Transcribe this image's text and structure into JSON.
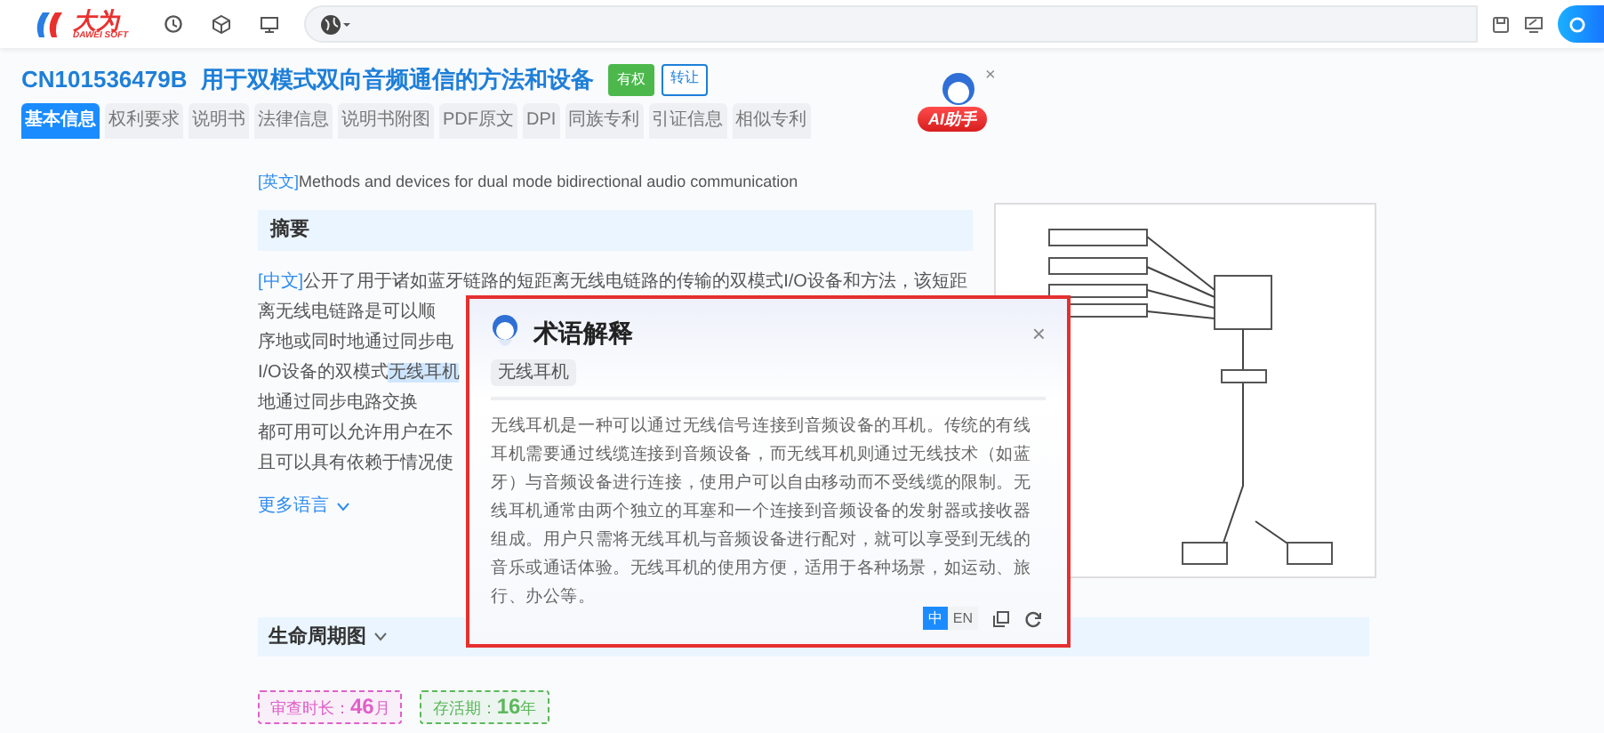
{
  "header": {
    "logo": {
      "name": "大为",
      "subtitle": "DAWEI SOFT"
    }
  },
  "patent": {
    "number": "CN101536479B",
    "title": "用于双模式双向音频通信的方法和设备",
    "tags": [
      {
        "label": "有权",
        "kind": "solid"
      },
      {
        "label": "转让",
        "kind": "outline"
      }
    ]
  },
  "tabs": [
    {
      "label": "基本信息",
      "selected": true
    },
    {
      "label": "权利要求",
      "selected": false
    },
    {
      "label": "说明书",
      "selected": false
    },
    {
      "label": "法律信息",
      "selected": false
    },
    {
      "label": "说明书附图",
      "selected": false
    },
    {
      "label": "PDF原文",
      "selected": false
    },
    {
      "label": "DPI",
      "selected": false
    },
    {
      "label": "同族专利",
      "selected": false
    },
    {
      "label": "引证信息",
      "selected": false
    },
    {
      "label": "相似专利",
      "selected": false
    }
  ],
  "assistant": {
    "label": "AI助手",
    "close": "×"
  },
  "english": {
    "tag": "[英文]",
    "text": "Methods and devices for dual mode bidirectional audio communication"
  },
  "abstract": {
    "heading": "摘要",
    "tag": "[中文]",
    "lines": [
      {
        "segments": [
          {
            "text": "公开了用于诸如蓝牙链路的短距离无线电链路的传输的双模式I/O设备和方法，该短距离无线电链路是可以顺",
            "highlighted": false
          }
        ]
      },
      {
        "segments": [
          {
            "text": "序地或同时地通过同步电",
            "highlighted": false
          }
        ]
      },
      {
        "segments": [
          {
            "text": "I/O设备的双模式",
            "highlighted": false
          },
          {
            "text": "无线耳机",
            "highlighted": true
          }
        ]
      },
      {
        "segments": [
          {
            "text": "地通过同步电路交换",
            "highlighted": false
          }
        ]
      },
      {
        "segments": [
          {
            "text": "都可用可以允许用户在不",
            "highlighted": false
          }
        ]
      },
      {
        "segments": [
          {
            "text": "且可以具有依赖于情况使",
            "highlighted": false
          }
        ]
      }
    ]
  },
  "more_languages": "更多语言",
  "lifecycle": {
    "heading": "生命周期图",
    "metrics": [
      {
        "label": "审查时长：",
        "value": "46",
        "unit": "月",
        "color": "#e060c8"
      },
      {
        "label": "存活期：",
        "value": "16",
        "unit": "年",
        "color": "#5cb85c"
      }
    ]
  },
  "popup": {
    "title": "术语解释",
    "close": "×",
    "term": "无线耳机",
    "body": "无线耳机是一种可以通过无线信号连接到音频设备的耳机。传统的有线耳机需要通过线缆连接到音频设备，而无线耳机则通过无线技术（如蓝牙）与音频设备进行连接，使用户可以自由移动而不受线缆的限制。无线耳机通常由两个独立的耳塞和一个连接到音频设备的发射器或接收器组成。用户只需将无线耳机与音频设备进行配对，就可以享受到无线的音乐或通话体验。无线耳机的使用方便，适用于各种场景，如运动、旅行、办公等。",
    "languages": [
      {
        "label": "中",
        "selected": true
      },
      {
        "label": "EN",
        "selected": false
      }
    ]
  }
}
